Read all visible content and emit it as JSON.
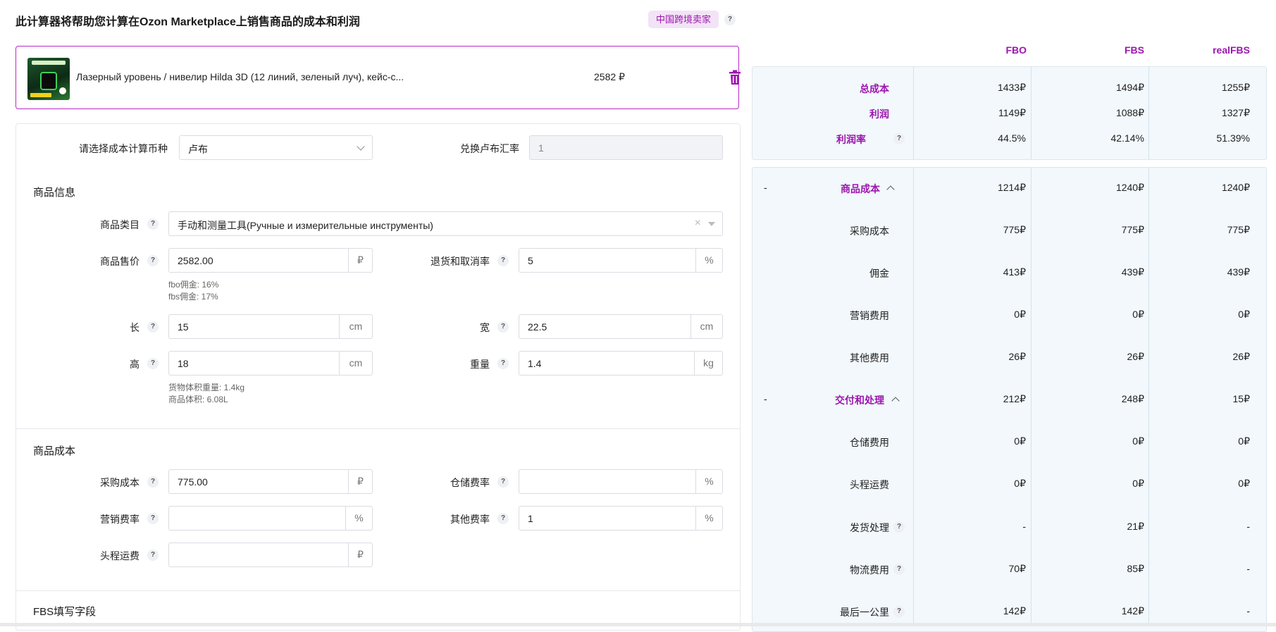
{
  "header": {
    "title": "此计算器将帮助您计算在Ozon Marketplace上销售商品的成本和利润",
    "seller_badge": "中国跨境卖家",
    "help": "?"
  },
  "product": {
    "name": "Лазерный уровень / нивелир Hilda 3D (12 линий, зеленый луч), кейс-с...",
    "price": "2582 ₽",
    "icons": {
      "thumbnail": "product-image",
      "delete": "trash-icon"
    },
    "colors": {
      "accent": "#9c16ad"
    }
  },
  "currency": {
    "label": "请选择成本计算币种",
    "value": "卢布",
    "rate_label": "兑换卢布汇率",
    "rate_value": "1"
  },
  "goods_info": {
    "title": "商品信息",
    "category_label": "商品类目",
    "category_value": "手动和测量工具(Ручные и измерительные инструменты)",
    "price_label": "商品售价",
    "price_value": "2582.00",
    "price_unit": "₽",
    "return_label": "退货和取消率",
    "return_value": "5",
    "return_unit": "%",
    "fbo_commission": "fbo佣金: 16%",
    "fbs_commission": "fbs佣金: 17%",
    "length_label": "长",
    "length_value": "15",
    "width_label": "宽",
    "width_value": "22.5",
    "height_label": "高",
    "height_value": "18",
    "weight_label": "重量",
    "weight_value": "1.4",
    "unit_cm": "cm",
    "unit_kg": "kg",
    "vol_weight": "货物体积重量: 1.4kg",
    "volume": "商品体积: 6.08L"
  },
  "goods_cost": {
    "title": "商品成本",
    "purchase_label": "采购成本",
    "purchase_value": "775.00",
    "purchase_unit": "₽",
    "storage_label": "仓储费率",
    "storage_value": "",
    "storage_unit": "%",
    "marketing_label": "营销费率",
    "marketing_value": "",
    "marketing_unit": "%",
    "other_label": "其他费率",
    "other_value": "1",
    "other_unit": "%",
    "freight_label": "头程运费",
    "freight_value": "",
    "freight_unit": "₽"
  },
  "fbs_section": {
    "title": "FBS填写字段"
  },
  "results": {
    "columns": [
      "FBO",
      "FBS",
      "realFBS"
    ],
    "summary": [
      {
        "label": "总成本",
        "values": [
          "1433₽",
          "1494₽",
          "1255₽"
        ]
      },
      {
        "label": "利润",
        "values": [
          "1149₽",
          "1088₽",
          "1327₽"
        ]
      },
      {
        "label": "利润率",
        "values": [
          "44.5%",
          "42.14%",
          "51.39%"
        ]
      }
    ],
    "details": [
      {
        "toggle": "-",
        "label": "商品成本",
        "values": [
          "1214₽",
          "1240₽",
          "1240₽"
        ]
      },
      {
        "toggle": "",
        "label": "采购成本",
        "values": [
          "775₽",
          "775₽",
          "775₽"
        ]
      },
      {
        "toggle": "",
        "label": "佣金",
        "values": [
          "413₽",
          "439₽",
          "439₽"
        ]
      },
      {
        "toggle": "",
        "label": "营销费用",
        "values": [
          "0₽",
          "0₽",
          "0₽"
        ]
      },
      {
        "toggle": "",
        "label": "其他费用",
        "values": [
          "26₽",
          "26₽",
          "26₽"
        ]
      },
      {
        "toggle": "-",
        "label": "交付和处理",
        "values": [
          "212₽",
          "248₽",
          "15₽"
        ]
      },
      {
        "toggle": "",
        "label": "仓储费用",
        "values": [
          "0₽",
          "0₽",
          "0₽"
        ]
      },
      {
        "toggle": "",
        "label": "头程运费",
        "values": [
          "0₽",
          "0₽",
          "0₽"
        ]
      },
      {
        "toggle": "",
        "label": "发货处理",
        "values": [
          "-",
          "21₽",
          "-"
        ]
      },
      {
        "toggle": "",
        "label": "物流费用",
        "values": [
          "70₽",
          "85₽",
          "-"
        ]
      },
      {
        "toggle": "",
        "label": "最后一公里",
        "values": [
          "142₽",
          "142₽",
          "-"
        ]
      }
    ]
  }
}
